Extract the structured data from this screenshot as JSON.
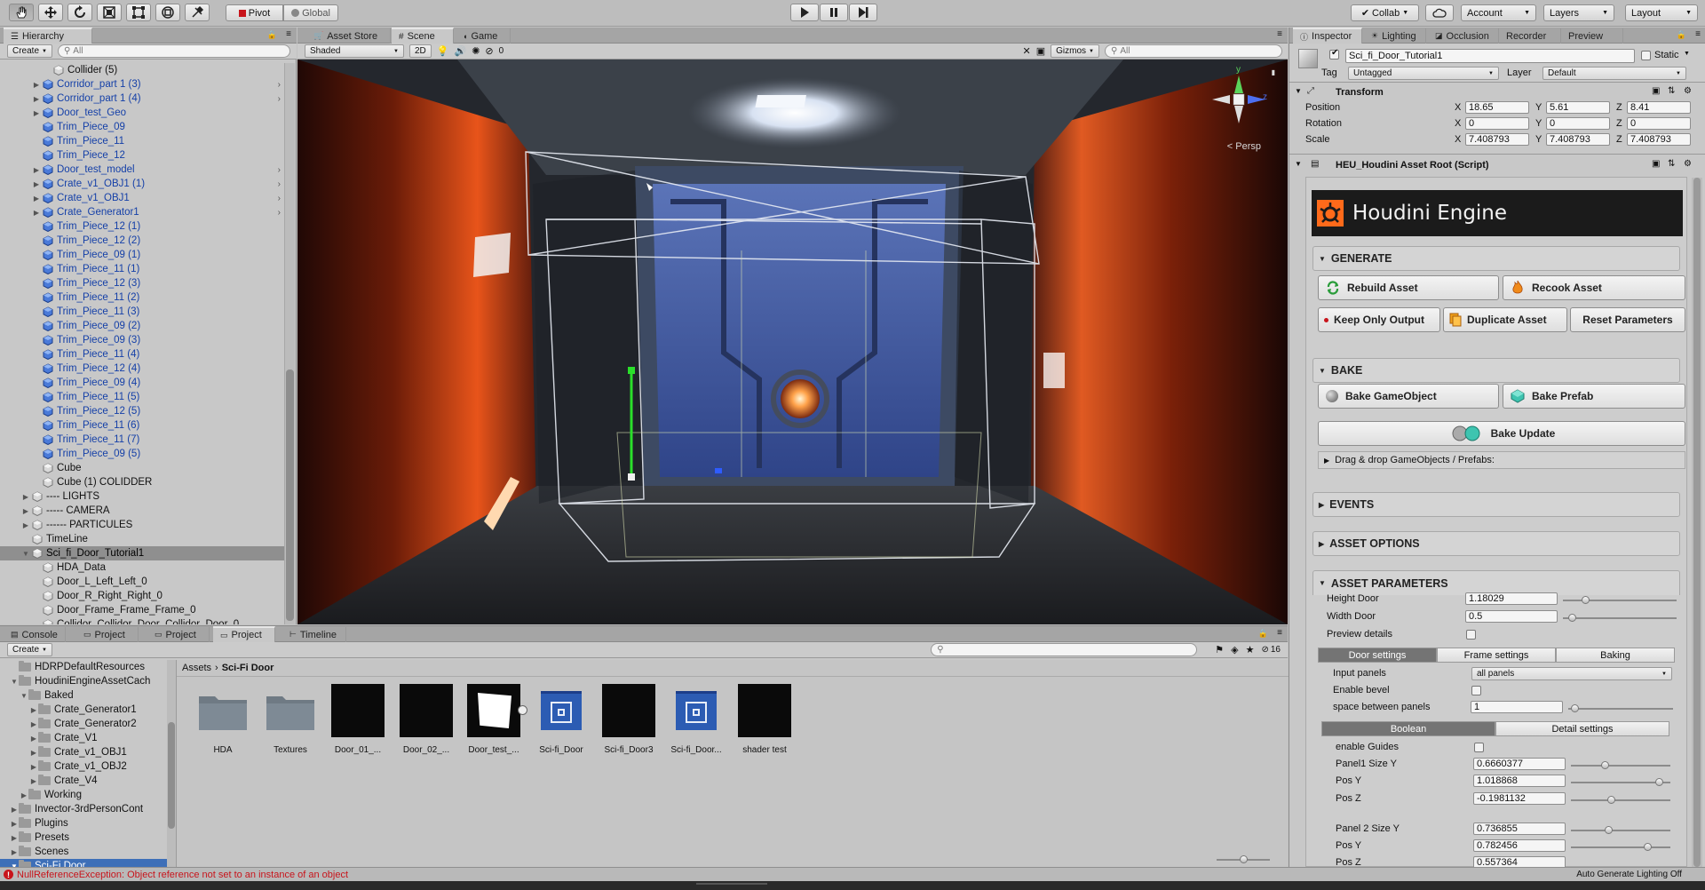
{
  "toolbar": {
    "tools": [
      "hand-tool-icon",
      "move-tool-icon",
      "rotate-tool-icon",
      "scale-tool-icon",
      "rect-tool-icon",
      "transform-tool-icon",
      "custom-tool-icon"
    ],
    "pivot_label": "Pivot",
    "global_label": "Global",
    "collab_label": "Collab",
    "account_label": "Account",
    "layers_label": "Layers",
    "layout_label": "Layout"
  },
  "hierarchy": {
    "tab_label": "Hierarchy",
    "create_label": "Create",
    "search_placeholder": "All",
    "rows": [
      {
        "label": "Collider (5)",
        "indent": 4,
        "arrow": "",
        "type": "gray",
        "sel": false,
        "more": false
      },
      {
        "label": "Corridor_part 1 (3)",
        "indent": 3,
        "arrow": "▶",
        "type": "blue",
        "sel": false,
        "more": true
      },
      {
        "label": "Corridor_part 1 (4)",
        "indent": 3,
        "arrow": "▶",
        "type": "blue",
        "sel": false,
        "more": true
      },
      {
        "label": "Door_test_Geo",
        "indent": 3,
        "arrow": "▶",
        "type": "blue",
        "sel": false,
        "more": false
      },
      {
        "label": "Trim_Piece_09",
        "indent": 3,
        "arrow": "",
        "type": "blue",
        "sel": false,
        "more": false
      },
      {
        "label": "Trim_Piece_11",
        "indent": 3,
        "arrow": "",
        "type": "blue",
        "sel": false,
        "more": false
      },
      {
        "label": "Trim_Piece_12",
        "indent": 3,
        "arrow": "",
        "type": "blue",
        "sel": false,
        "more": false
      },
      {
        "label": "Door_test_model",
        "indent": 3,
        "arrow": "▶",
        "type": "blue",
        "sel": false,
        "more": true
      },
      {
        "label": "Crate_v1_OBJ1 (1)",
        "indent": 3,
        "arrow": "▶",
        "type": "blue",
        "sel": false,
        "more": true
      },
      {
        "label": "Crate_v1_OBJ1",
        "indent": 3,
        "arrow": "▶",
        "type": "blue",
        "sel": false,
        "more": true
      },
      {
        "label": "Crate_Generator1",
        "indent": 3,
        "arrow": "▶",
        "type": "blue",
        "sel": false,
        "more": true
      },
      {
        "label": "Trim_Piece_12 (1)",
        "indent": 3,
        "arrow": "",
        "type": "blue",
        "sel": false,
        "more": false
      },
      {
        "label": "Trim_Piece_12 (2)",
        "indent": 3,
        "arrow": "",
        "type": "blue",
        "sel": false,
        "more": false
      },
      {
        "label": "Trim_Piece_09 (1)",
        "indent": 3,
        "arrow": "",
        "type": "blue",
        "sel": false,
        "more": false
      },
      {
        "label": "Trim_Piece_11 (1)",
        "indent": 3,
        "arrow": "",
        "type": "blue",
        "sel": false,
        "more": false
      },
      {
        "label": "Trim_Piece_12 (3)",
        "indent": 3,
        "arrow": "",
        "type": "blue",
        "sel": false,
        "more": false
      },
      {
        "label": "Trim_Piece_11 (2)",
        "indent": 3,
        "arrow": "",
        "type": "blue",
        "sel": false,
        "more": false
      },
      {
        "label": "Trim_Piece_11 (3)",
        "indent": 3,
        "arrow": "",
        "type": "blue",
        "sel": false,
        "more": false
      },
      {
        "label": "Trim_Piece_09 (2)",
        "indent": 3,
        "arrow": "",
        "type": "blue",
        "sel": false,
        "more": false
      },
      {
        "label": "Trim_Piece_09 (3)",
        "indent": 3,
        "arrow": "",
        "type": "blue",
        "sel": false,
        "more": false
      },
      {
        "label": "Trim_Piece_11 (4)",
        "indent": 3,
        "arrow": "",
        "type": "blue",
        "sel": false,
        "more": false
      },
      {
        "label": "Trim_Piece_12 (4)",
        "indent": 3,
        "arrow": "",
        "type": "blue",
        "sel": false,
        "more": false
      },
      {
        "label": "Trim_Piece_09 (4)",
        "indent": 3,
        "arrow": "",
        "type": "blue",
        "sel": false,
        "more": false
      },
      {
        "label": "Trim_Piece_11 (5)",
        "indent": 3,
        "arrow": "",
        "type": "blue",
        "sel": false,
        "more": false
      },
      {
        "label": "Trim_Piece_12 (5)",
        "indent": 3,
        "arrow": "",
        "type": "blue",
        "sel": false,
        "more": false
      },
      {
        "label": "Trim_Piece_11 (6)",
        "indent": 3,
        "arrow": "",
        "type": "blue",
        "sel": false,
        "more": false
      },
      {
        "label": "Trim_Piece_11 (7)",
        "indent": 3,
        "arrow": "",
        "type": "blue",
        "sel": false,
        "more": false
      },
      {
        "label": "Trim_Piece_09 (5)",
        "indent": 3,
        "arrow": "",
        "type": "blue",
        "sel": false,
        "more": false
      },
      {
        "label": "Cube",
        "indent": 3,
        "arrow": "",
        "type": "gray",
        "sel": false,
        "more": false
      },
      {
        "label": "Cube (1) COLIDDER",
        "indent": 3,
        "arrow": "",
        "type": "gray",
        "sel": false,
        "more": false
      },
      {
        "label": "---- LIGHTS",
        "indent": 2,
        "arrow": "▶",
        "type": "gray",
        "sel": false,
        "more": false
      },
      {
        "label": "----- CAMERA",
        "indent": 2,
        "arrow": "▶",
        "type": "gray",
        "sel": false,
        "more": false
      },
      {
        "label": "------ PARTICULES",
        "indent": 2,
        "arrow": "▶",
        "type": "gray",
        "sel": false,
        "more": false
      },
      {
        "label": "TimeLine",
        "indent": 2,
        "arrow": "",
        "type": "gray",
        "sel": false,
        "more": false
      },
      {
        "label": "Sci_fi_Door_Tutorial1",
        "indent": 2,
        "arrow": "▼",
        "type": "gray",
        "sel": true,
        "more": false
      },
      {
        "label": "HDA_Data",
        "indent": 3,
        "arrow": "",
        "type": "gray",
        "sel": false,
        "more": false
      },
      {
        "label": "Door_L_Left_Left_0",
        "indent": 3,
        "arrow": "",
        "type": "gray",
        "sel": false,
        "more": false
      },
      {
        "label": "Door_R_Right_Right_0",
        "indent": 3,
        "arrow": "",
        "type": "gray",
        "sel": false,
        "more": false
      },
      {
        "label": "Door_Frame_Frame_Frame_0",
        "indent": 3,
        "arrow": "",
        "type": "gray",
        "sel": false,
        "more": false
      },
      {
        "label": "Collidor_Collidor_Door_Collidor_Door_0",
        "indent": 3,
        "arrow": "",
        "type": "gray",
        "sel": false,
        "more": false
      }
    ]
  },
  "scene": {
    "tabs": [
      "Asset Store",
      "Scene",
      "Game"
    ],
    "shading_mode": "Shaded",
    "mode_2d": "2D",
    "effects_count": "0",
    "gizmos_label": "Gizmos",
    "search_placeholder": "All",
    "persp_label": "Persp",
    "axis_y": "y",
    "axis_z": "z"
  },
  "project": {
    "tabs": [
      "Console",
      "Project",
      "Project",
      "Project",
      "Timeline"
    ],
    "create_label": "Create",
    "breadcrumb_root": "Assets",
    "breadcrumb_current": "Sci-Fi Door",
    "hidden_count": "16",
    "tree": [
      {
        "label": "HDRPDefaultResources",
        "indent": 1,
        "arrow": "",
        "sel": false
      },
      {
        "label": "HoudiniEngineAssetCach",
        "indent": 1,
        "arrow": "▼",
        "sel": false
      },
      {
        "label": "Baked",
        "indent": 2,
        "arrow": "▼",
        "sel": false
      },
      {
        "label": "Crate_Generator1",
        "indent": 3,
        "arrow": "▶",
        "sel": false
      },
      {
        "label": "Crate_Generator2",
        "indent": 3,
        "arrow": "▶",
        "sel": false
      },
      {
        "label": "Crate_V1",
        "indent": 3,
        "arrow": "▶",
        "sel": false
      },
      {
        "label": "Crate_v1_OBJ1",
        "indent": 3,
        "arrow": "▶",
        "sel": false
      },
      {
        "label": "Crate_v1_OBJ2",
        "indent": 3,
        "arrow": "▶",
        "sel": false
      },
      {
        "label": "Crate_V4",
        "indent": 3,
        "arrow": "▶",
        "sel": false
      },
      {
        "label": "Working",
        "indent": 2,
        "arrow": "▶",
        "sel": false
      },
      {
        "label": "Invector-3rdPersonCont",
        "indent": 1,
        "arrow": "▶",
        "sel": false
      },
      {
        "label": "Plugins",
        "indent": 1,
        "arrow": "▶",
        "sel": false
      },
      {
        "label": "Presets",
        "indent": 1,
        "arrow": "▶",
        "sel": false
      },
      {
        "label": "Scenes",
        "indent": 1,
        "arrow": "▶",
        "sel": false
      },
      {
        "label": "Sci-Fi Door",
        "indent": 1,
        "arrow": "▼",
        "sel": true
      }
    ],
    "assets": [
      {
        "label": "HDA",
        "kind": "folder"
      },
      {
        "label": "Textures",
        "kind": "folder"
      },
      {
        "label": "Door_01_...",
        "kind": "black"
      },
      {
        "label": "Door_02_...",
        "kind": "black"
      },
      {
        "label": "Door_test_...",
        "kind": "white"
      },
      {
        "label": "Sci-fi_Door",
        "kind": "prefab"
      },
      {
        "label": "Sci-fi_Door3",
        "kind": "black"
      },
      {
        "label": "Sci-fi_Door...",
        "kind": "prefab"
      },
      {
        "label": "shader test",
        "kind": "black"
      }
    ]
  },
  "inspector": {
    "tabs": [
      "Inspector",
      "Lighting",
      "Occlusion",
      "Recorder",
      "Preview"
    ],
    "object_name": "Sci_fi_Door_Tutorial1",
    "static_label": "Static",
    "tag_label": "Tag",
    "tag_value": "Untagged",
    "layer_label": "Layer",
    "layer_value": "Default",
    "transform_title": "Transform",
    "position_label": "Position",
    "rotation_label": "Rotation",
    "scale_label": "Scale",
    "axis_x": "X",
    "axis_y": "Y",
    "axis_z": "Z",
    "position": [
      "18.65",
      "5.61",
      "8.41"
    ],
    "rotation": [
      "0",
      "0",
      "0"
    ],
    "scale": [
      "7.408793",
      "7.408793",
      "7.408793"
    ],
    "script_title": "HEU_Houdini Asset Root (Script)",
    "houdini_title": "Houdini Engine",
    "generate_label": "GENERATE",
    "rebuild_label": "Rebuild Asset",
    "recook_label": "Recook Asset",
    "keep_output_label": "Keep Only Output",
    "duplicate_label": "Duplicate Asset",
    "reset_label": "Reset Parameters",
    "bake_label": "BAKE",
    "bake_go_label": "Bake GameObject",
    "bake_prefab_label": "Bake Prefab",
    "bake_update_label": "Bake Update",
    "drag_drop_label": "Drag & drop GameObjects / Prefabs:",
    "events_label": "EVENTS",
    "asset_options_label": "ASSET OPTIONS",
    "asset_params_label": "ASSET PARAMETERS",
    "height_door_label": "Height Door",
    "height_door_value": "1.18029",
    "height_door_level": 0.18,
    "width_door_label": "Width Door",
    "width_door_value": "0.5",
    "width_door_level": 0.05,
    "preview_details_label": "Preview details",
    "subtabs": [
      "Door settings",
      "Frame settings",
      "Baking"
    ],
    "input_panels_label": "Input panels",
    "input_panels_value": "all panels",
    "enable_bevel_label": "Enable bevel",
    "space_panels_label": "space between panels",
    "space_panels_value": "1",
    "space_panels_level": 0.03,
    "subtabs2": [
      "Boolean",
      "Detail settings"
    ],
    "enable_guides_label": "enable Guides",
    "panel1_label": "Panel1 Size Y",
    "panel1_value": "0.6660377",
    "panel1_level": 0.33,
    "posy1_label": "Pos Y",
    "posy1_value": "1.018868",
    "posy1_level": 0.92,
    "posz1_label": "Pos Z",
    "posz1_value": "-0.1981132",
    "posz1_level": 0.4,
    "panel2_label": "Panel 2 Size Y",
    "panel2_value": "0.736855",
    "panel2_level": 0.37,
    "posy2_label": "Pos Y",
    "posy2_value": "0.782456",
    "posy2_level": 0.8,
    "posz2_label": "Pos Z",
    "posz2_value": "0.557364"
  },
  "status": {
    "error_message": "NullReferenceException: Object reference not set to an instance of an object",
    "right_label": "Auto Generate Lighting Off"
  },
  "colors": {
    "error_red": "#c8141b",
    "houdini_orange": "#ff6a1a",
    "selection_blue": "#3d6fb8",
    "object_blue": "#1540a8"
  }
}
